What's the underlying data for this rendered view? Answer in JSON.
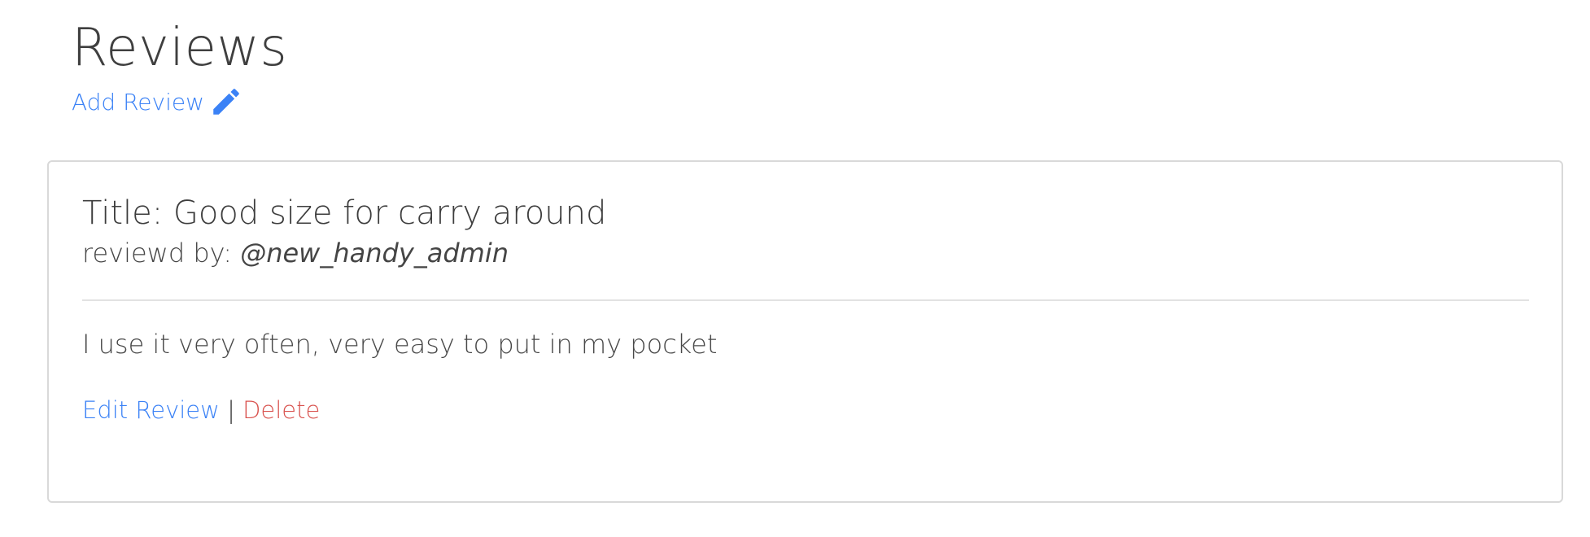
{
  "header": {
    "title": "Reviews",
    "add_review_label": "Add Review",
    "add_review_icon": "pencil-icon"
  },
  "review": {
    "title": "Title: Good size for carry around",
    "reviewer_prefix": "reviewd by:",
    "reviewer_handle": "@new_handy_admin",
    "body": "I use it very often, very easy to put in my pocket",
    "edit_label": "Edit Review",
    "separator": "|",
    "delete_label": "Delete"
  },
  "colors": {
    "link": "#3b82f6",
    "delete": "#d9534f",
    "text": "#444444",
    "border": "#d9d9d9"
  }
}
